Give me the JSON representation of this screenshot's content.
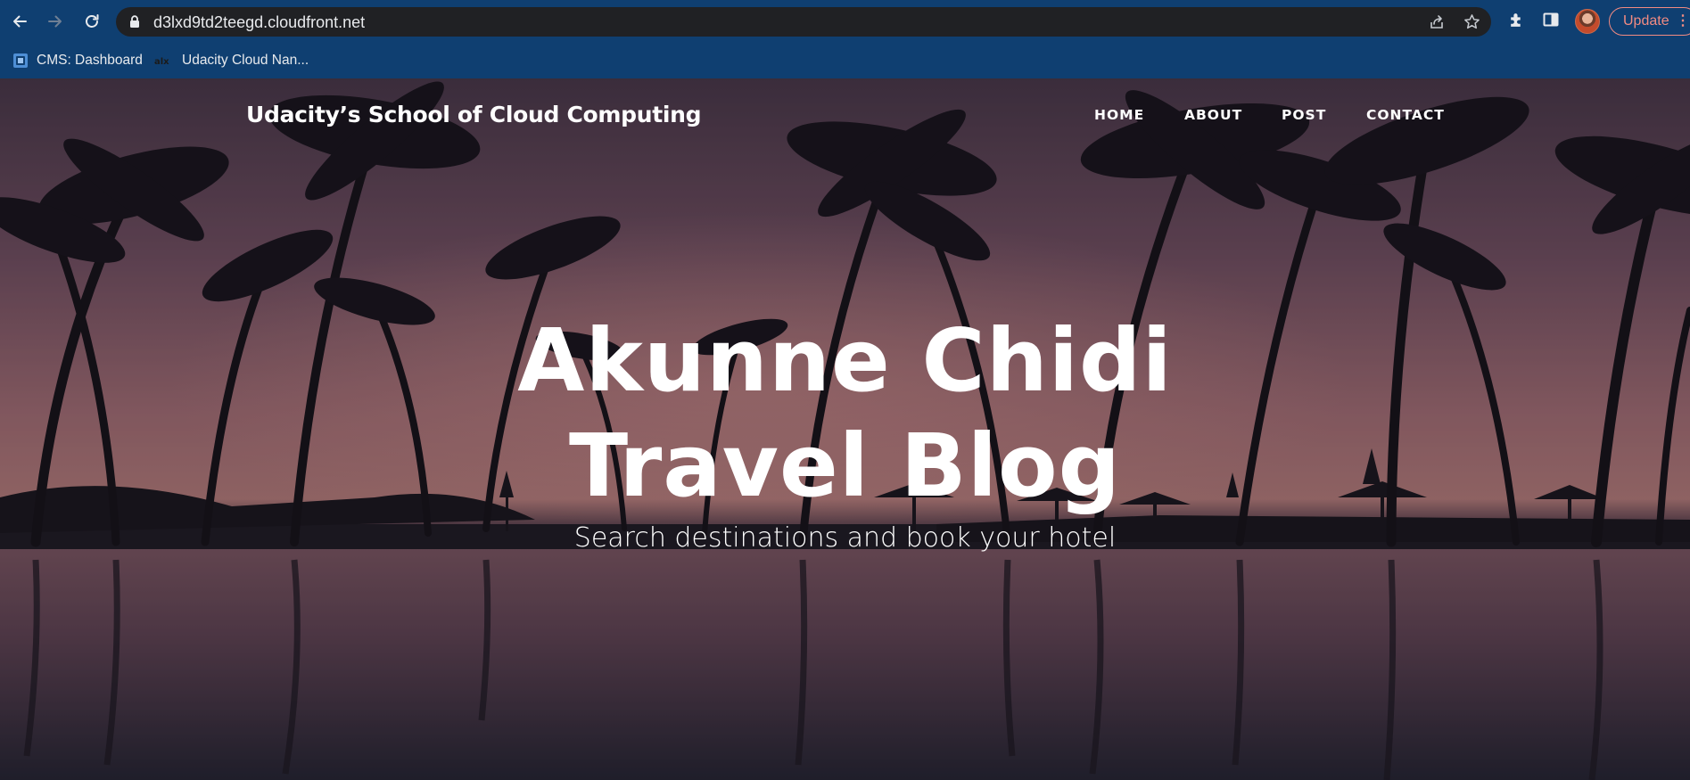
{
  "browser": {
    "url": "d3lxd9td2teegd.cloudfront.net",
    "update_label": "Update",
    "menu_glyph": "⋮",
    "bookmarks": [
      {
        "label": "CMS: Dashboard",
        "icon": "cms-bookmark-icon"
      },
      {
        "label": "Udacity Cloud Nan...",
        "icon": "alx-bookmark-icon"
      }
    ],
    "colors": {
      "chrome": "#0f3f71",
      "omnibox": "#202124",
      "update_accent": "#f28b82"
    }
  },
  "site": {
    "brand": "Udacity’s School of Cloud Computing",
    "nav": [
      "HOME",
      "ABOUT",
      "POST",
      "CONTACT"
    ],
    "hero": {
      "title_line1": "Akunne Chidi",
      "title_line2": "Travel Blog",
      "subtitle": "Search destinations and book your hotel"
    }
  }
}
